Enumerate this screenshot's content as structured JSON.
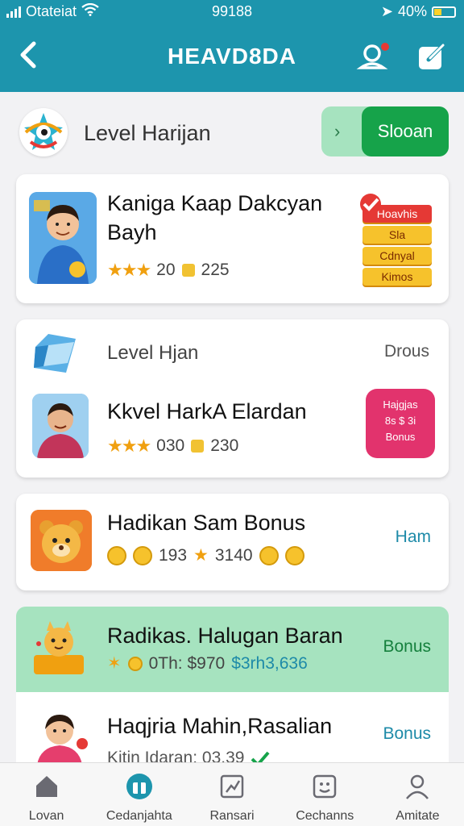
{
  "status_bar": {
    "carrier": "Otateiat",
    "time": "99188",
    "battery": "40%"
  },
  "app_bar": {
    "title": "HEAVD8DA"
  },
  "level_header": {
    "label": "Level Harijan",
    "toggle_label": "Slooan"
  },
  "card1": {
    "title": "Kaniga Kaap Dakcyan Bayh",
    "stars": "★★★",
    "count": "20",
    "points": "225",
    "gift_labels": [
      "Hoavhis",
      "Sla",
      "Cdnyal",
      "Kimos"
    ]
  },
  "card2": {
    "header_label": "Level Hjan",
    "header_right": "Drous",
    "title": "Kkvel HarkA Elardan",
    "stars": "★★★",
    "count": "030",
    "points": "230",
    "badge_lines": [
      "Hajgjas",
      "8s $ 3i",
      "Bonus"
    ]
  },
  "card3": {
    "title": "Hadikan Sam Bonus",
    "count": "193",
    "points": "3140",
    "link": "Ham"
  },
  "card4": {
    "title": "Radikas. Halugan Baran",
    "meta": "0Th: $970",
    "meta2": "$3rh3,636",
    "link": "Bonus"
  },
  "card5": {
    "title": "Haqjria Mahin,Rasalian",
    "meta": "Kitin Idaran: 03.39",
    "link": "Bonus"
  },
  "bottom_nav": [
    {
      "label": "Lovan",
      "icon": "home-icon"
    },
    {
      "label": "Cedanjahta",
      "icon": "gift-icon"
    },
    {
      "label": "Ransari",
      "icon": "chart-icon"
    },
    {
      "label": "Cechanns",
      "icon": "face-icon"
    },
    {
      "label": "Amitate",
      "icon": "user-icon"
    }
  ],
  "colors": {
    "primary": "#1d95ad",
    "accent_green": "#16a34a",
    "mint": "#a6e3bf",
    "pink": "#e2336d",
    "gold": "#f6c22c"
  }
}
